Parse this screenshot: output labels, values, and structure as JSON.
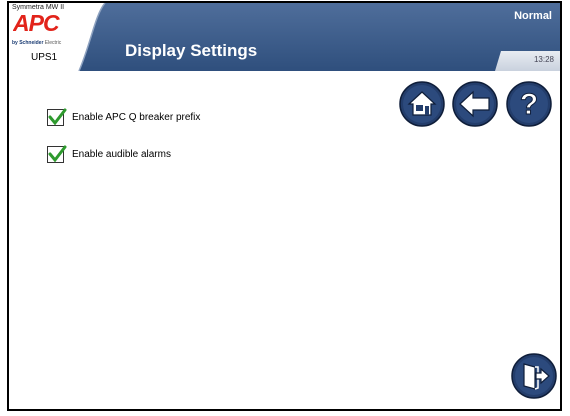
{
  "header": {
    "product_line": "Symmetra MW II",
    "brand": "APC",
    "byline_company": "by Schneider",
    "byline_suffix": "Electric",
    "unit_name": "UPS1",
    "page_title": "Display Settings",
    "status": "Normal",
    "time": "13:28"
  },
  "nav": {
    "home": "home-icon",
    "back": "back-arrow-icon",
    "help": "help-icon",
    "exit": "exit-door-icon"
  },
  "options": [
    {
      "label": "Enable APC Q breaker prefix",
      "checked": true
    },
    {
      "label": "Enable audible alarms",
      "checked": true
    }
  ],
  "colors": {
    "header_blue": "#3f5f8c",
    "brand_red": "#e2231a",
    "check_green": "#2e9a2e",
    "button_blue": "#233d6b"
  }
}
